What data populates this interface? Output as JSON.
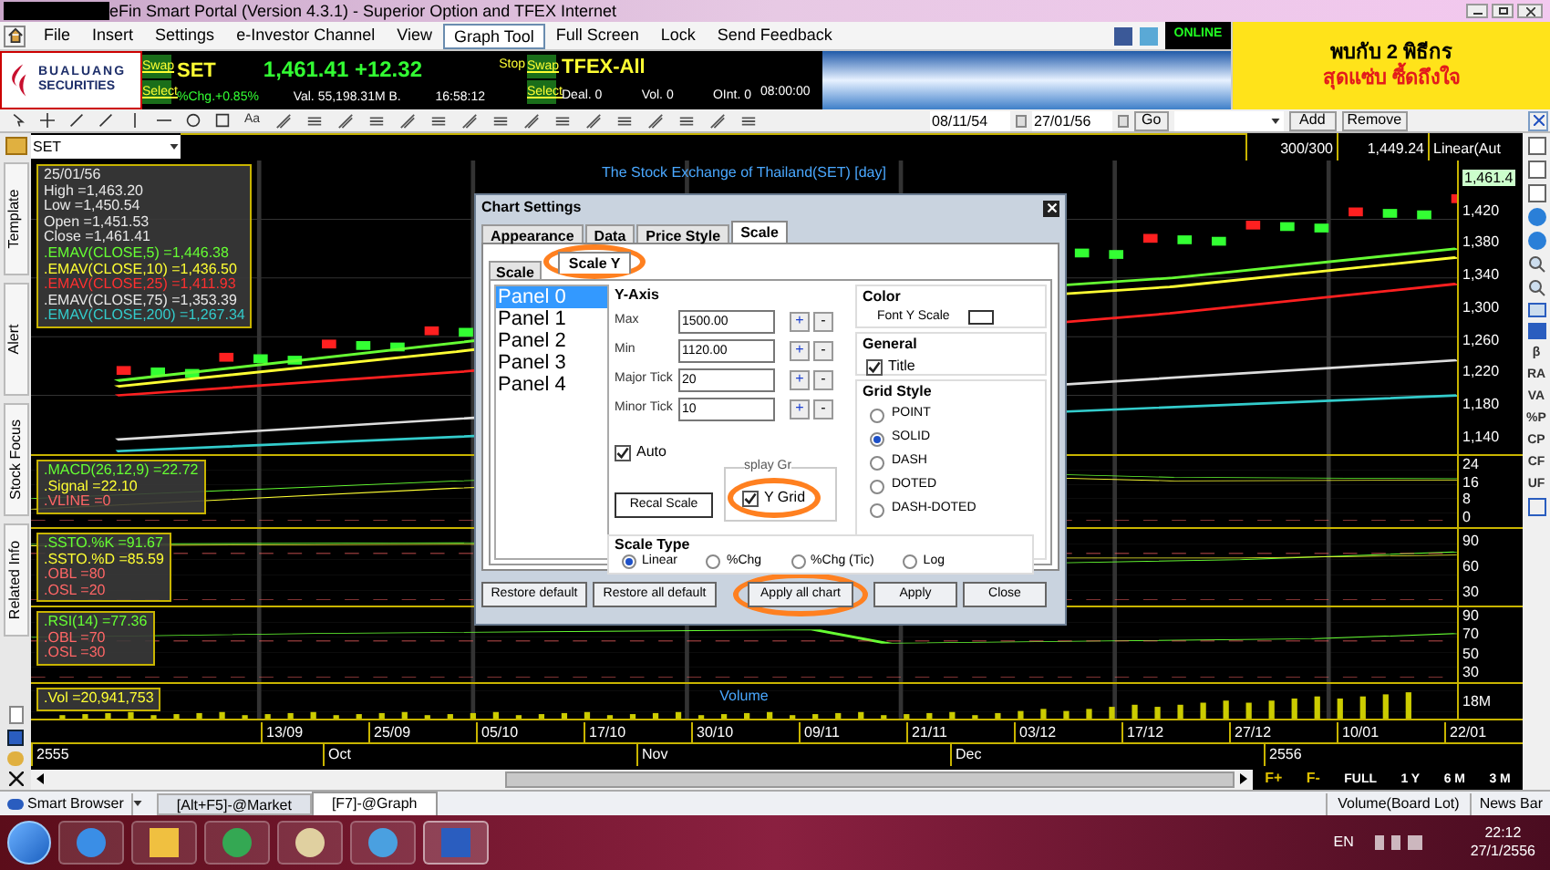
{
  "window": {
    "title": "eFin Smart Portal (Version 4.3.1) - Superior Option and TFEX Internet"
  },
  "menu": [
    {
      "label": "File",
      "selected": false
    },
    {
      "label": "Insert",
      "selected": false
    },
    {
      "label": "Settings",
      "selected": false
    },
    {
      "label": "e-Investor Channel",
      "selected": false
    },
    {
      "label": "View",
      "selected": false
    },
    {
      "label": "Graph Tool",
      "selected": true
    },
    {
      "label": "Full Screen",
      "selected": false
    },
    {
      "label": "Lock",
      "selected": false
    },
    {
      "label": "Send Feedback",
      "selected": false
    }
  ],
  "status": "ONLINE",
  "logo": {
    "line1": "BUALUANG",
    "line2": "SECURITIES"
  },
  "ad": {
    "lines": [
      "พบกับ 2 พิธีกร",
      "สุดแซ่บ ซี้ดถึงใจ"
    ]
  },
  "set_quote": {
    "swap": "Swap",
    "select": "Select",
    "symbol": "SET",
    "price": "1,461.41 +12.32",
    "change": "%Chg.+0.85%",
    "value": "Val. 55,198.31M B.",
    "time": "16:58:12"
  },
  "tfex_quote": {
    "stop": "Stop",
    "swap": "Swap",
    "select": "Select",
    "symbol": "TFEX-All",
    "deal": "Deal. 0",
    "vol": "Vol. 0",
    "oint": "OInt. 0",
    "time": "08:00:00"
  },
  "toolbar": {
    "text_tool": "Aa",
    "date_from": "08/11/54",
    "date_to": "27/01/56",
    "go": "Go",
    "add": "Add",
    "remove": "Remove"
  },
  "symbol_box": {
    "value": "SET"
  },
  "chart_header": {
    "count": "300/300",
    "value": "1,449.24",
    "scale": "Linear(Aut"
  },
  "side_tabs": [
    "Template",
    "Alert",
    "Stock Focus",
    "Related Info"
  ],
  "panels": [
    {
      "kind": "price",
      "title": "The Stock Exchange of Thailand(SET) [day]",
      "legend": [
        {
          "text": "25/01/56",
          "color": "#e8e8e8"
        },
        {
          "text": "High =1,463.20",
          "color": "#e8e8e8"
        },
        {
          "text": "Low =1,450.54",
          "color": "#e8e8e8"
        },
        {
          "text": "Open =1,451.53",
          "color": "#e8e8e8"
        },
        {
          "text": "Close =1,461.41",
          "color": "#e8e8e8"
        },
        {
          "text": ".EMAV(CLOSE,5)  =1,446.38",
          "color": "#66ff33"
        },
        {
          "text": ".EMAV(CLOSE,10)  =1,436.50",
          "color": "#ffff33"
        },
        {
          "text": ".EMAV(CLOSE,25)  =1,411.93",
          "color": "#ff3030"
        },
        {
          "text": ".EMAV(CLOSE,75)  =1,353.39",
          "color": "#e8e8e8"
        },
        {
          "text": ".EMAV(CLOSE,200)  =1,267.34",
          "color": "#33cccc"
        }
      ],
      "current": "1,461.4",
      "ticks": [
        "1,420",
        "1,380",
        "1,340",
        "1,300",
        "1,260",
        "1,220",
        "1,180",
        "1,140"
      ]
    },
    {
      "kind": "macd",
      "legend": [
        {
          "text": ".MACD(26,12,9)  =22.72",
          "color": "#66ff33"
        },
        {
          "text": ".Signal  =22.10",
          "color": "#ffff33"
        },
        {
          "text": ".VLINE  =0",
          "color": "#ff6666"
        }
      ],
      "ticks": [
        "24",
        "16",
        "8",
        "0"
      ]
    },
    {
      "kind": "ssto",
      "legend": [
        {
          "text": ".SSTO.%K  =91.67",
          "color": "#66ff33"
        },
        {
          "text": ".SSTO.%D  =85.59",
          "color": "#ffff33"
        },
        {
          "text": ".OBL  =80",
          "color": "#ff6666"
        },
        {
          "text": ".OSL  =20",
          "color": "#ff6666"
        }
      ],
      "ticks": [
        "90",
        "60",
        "30"
      ]
    },
    {
      "kind": "rsi",
      "legend": [
        {
          "text": ".RSI(14)  =77.36",
          "color": "#66ff33"
        },
        {
          "text": ".OBL  =70",
          "color": "#ff6666"
        },
        {
          "text": ".OSL  =30",
          "color": "#ff6666"
        }
      ],
      "ticks": [
        "90",
        "70",
        "50",
        "30"
      ]
    },
    {
      "kind": "volume",
      "title": "Volume",
      "legend": [
        {
          "text": ".Vol  =20,941,753",
          "color": "#ffff33"
        }
      ],
      "ticks": [
        "18M"
      ]
    }
  ],
  "right_tools": [
    "β",
    "RA",
    "VA",
    "%P",
    "CP",
    "CF",
    "UF"
  ],
  "x_dates": [
    "13/09",
    "25/09",
    "05/10",
    "17/10",
    "30/10",
    "09/11",
    "21/11",
    "03/12",
    "17/12",
    "27/12",
    "10/01",
    "22/01"
  ],
  "x_months": [
    {
      "text": "2555"
    },
    {
      "text": "Oct"
    },
    {
      "text": "Nov"
    },
    {
      "text": "Dec"
    },
    {
      "text": "2556"
    }
  ],
  "periods": [
    "F+",
    "F-",
    "FULL",
    "1 Y",
    "6 M",
    "3 M"
  ],
  "bottom_tabs": [
    {
      "label": "[Alt+F5]-@Market",
      "selected": false
    },
    {
      "label": "[F7]-@Graph",
      "selected": true
    }
  ],
  "smart_browser": "Smart Browser",
  "bottom_right": [
    "Volume(Board Lot)",
    "News Bar"
  ],
  "dialog": {
    "title": "Chart Settings",
    "tabs": [
      {
        "label": "Appearance",
        "selected": false
      },
      {
        "label": "Data",
        "selected": false
      },
      {
        "label": "Price Style",
        "selected": false
      },
      {
        "label": "Scale",
        "selected": true
      }
    ],
    "subtabs": [
      {
        "label": "Scale",
        "selected": false
      },
      {
        "label": "Scale Y",
        "selected": true
      }
    ],
    "panels": [
      {
        "label": "Panel 0",
        "selected": true
      },
      {
        "label": "Panel 1",
        "selected": false
      },
      {
        "label": "Panel 2",
        "selected": false
      },
      {
        "label": "Panel 3",
        "selected": false
      },
      {
        "label": "Panel 4",
        "selected": false
      }
    ],
    "y_axis_title": "Y-Axis",
    "fields": [
      {
        "label": "Max",
        "value": "1500.00"
      },
      {
        "label": "Min",
        "value": "1120.00"
      },
      {
        "label": "Major Tick",
        "value": "20"
      },
      {
        "label": "Minor Tick",
        "value": "10"
      }
    ],
    "plus": "+",
    "minus": "-",
    "auto": {
      "label": "Auto",
      "checked": true
    },
    "recal": "Recal Scale",
    "grid_group": "splay Gr",
    "y_grid": {
      "label": "Y Grid",
      "checked": true
    },
    "color_title": "Color",
    "font_y_scale": "Font Y Scale",
    "general_title": "General",
    "title_option": {
      "label": "Title",
      "checked": true
    },
    "grid_style_title": "Grid Style",
    "grid_styles": [
      {
        "label": "POINT",
        "selected": false
      },
      {
        "label": "SOLID",
        "selected": true
      },
      {
        "label": "DASH",
        "selected": false
      },
      {
        "label": "DOTED",
        "selected": false
      },
      {
        "label": "DASH-DOTED",
        "selected": false
      }
    ],
    "scale_type_title": "Scale Type",
    "scale_types": [
      {
        "label": "Linear",
        "selected": true
      },
      {
        "label": "%Chg",
        "selected": false
      },
      {
        "label": "%Chg (Tic)",
        "selected": false
      },
      {
        "label": "Log",
        "selected": false
      }
    ],
    "buttons": [
      "Restore default",
      "Restore all default",
      "Apply all chart",
      "Apply",
      "Close"
    ]
  },
  "tray": {
    "lang": "EN",
    "time": "22:12",
    "date": "27/1/2556"
  }
}
